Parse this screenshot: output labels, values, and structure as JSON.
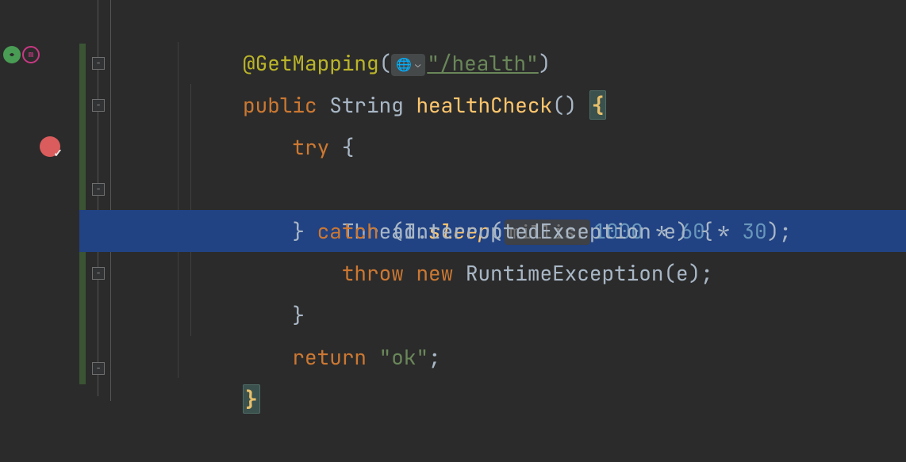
{
  "gutter": {
    "spring_icon": "●",
    "mapping_icon": "m",
    "breakpoint_check": "✓"
  },
  "code": {
    "line1": {
      "annotation": "@GetMapping",
      "lparen": "(",
      "url": "\"/health\"",
      "rparen": ")"
    },
    "line2": {
      "kw_public": "public",
      "type": " String ",
      "method": "healthCheck",
      "parens": "()",
      "space": " ",
      "brace": "{"
    },
    "line3": {
      "kw_try": "try",
      "rest": " {"
    },
    "line4": {
      "cls": "Thread",
      "dot": ".",
      "method": "sleep",
      "lparen": "(",
      "hint": "millis:",
      "expr_n1": "1000",
      "expr_op1": " * ",
      "expr_n2": "60",
      "expr_op2": " * ",
      "expr_n3": "30",
      "rparen_semi": ");"
    },
    "line5": {
      "close": "} ",
      "kw_catch": "catch",
      "rest": " (InterruptedException e) {"
    },
    "line6": {
      "kw_throw": "throw",
      "sp1": " ",
      "kw_new": "new",
      "rest": " RuntimeException(e);"
    },
    "line7": {
      "close": "}"
    },
    "line8": {
      "kw_return": "return",
      "sp": " ",
      "str": "\"ok\"",
      "semi": ";"
    },
    "line9": {
      "brace": "}"
    }
  },
  "fold": {
    "minus": "−"
  }
}
